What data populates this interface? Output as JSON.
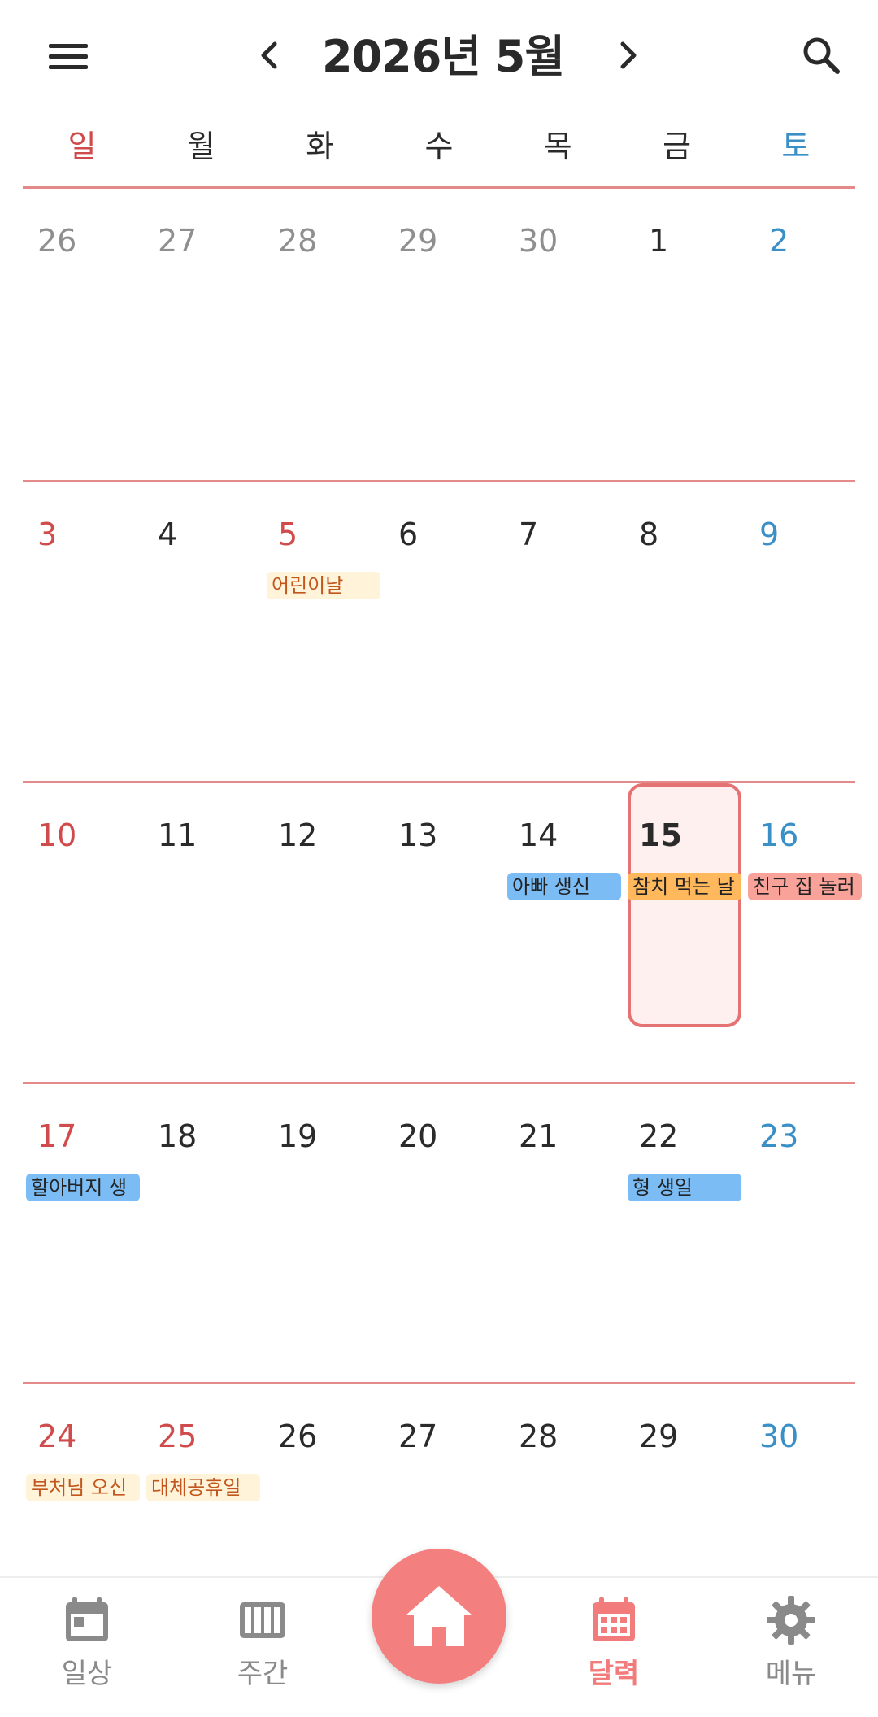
{
  "header": {
    "title": "2026년 5월",
    "menu_icon": "menu-icon",
    "prev_icon": "chevron-left-icon",
    "next_icon": "chevron-right-icon",
    "search_icon": "search-icon"
  },
  "weekdays": [
    "일",
    "월",
    "화",
    "수",
    "목",
    "금",
    "토"
  ],
  "colors": {
    "sunday": "#d04b4b",
    "saturday": "#3a8fc7",
    "accent": "#f47f7f",
    "divider": "#e58a8a"
  },
  "weeks": [
    {
      "days": [
        "26",
        "27",
        "28",
        "29",
        "30",
        "1",
        "2"
      ],
      "events": []
    },
    {
      "days": [
        "3",
        "4",
        "5",
        "6",
        "7",
        "8",
        "9"
      ],
      "events": [
        {
          "label": "어린이날"
        }
      ]
    },
    {
      "days": [
        "10",
        "11",
        "12",
        "13",
        "14",
        "15",
        "16"
      ],
      "events": [
        {
          "label": "아빠 생신"
        },
        {
          "label": "참치 먹는 날"
        },
        {
          "label": "친구 집 놀러"
        }
      ]
    },
    {
      "days": [
        "17",
        "18",
        "19",
        "20",
        "21",
        "22",
        "23"
      ],
      "events": [
        {
          "label": "할아버지 생"
        },
        {
          "label": "형 생일"
        }
      ]
    },
    {
      "days": [
        "24",
        "25",
        "26",
        "27",
        "28",
        "29",
        "30"
      ],
      "events": [
        {
          "label": "부처님 오신"
        },
        {
          "label": "대체공휴일"
        }
      ]
    }
  ],
  "bottom_nav": [
    {
      "label": "일상",
      "icon": "calendar-day-icon"
    },
    {
      "label": "주간",
      "icon": "week-columns-icon"
    },
    {
      "label": "",
      "icon": "home-icon"
    },
    {
      "label": "달력",
      "icon": "calendar-month-icon"
    },
    {
      "label": "메뉴",
      "icon": "gear-icon"
    }
  ]
}
